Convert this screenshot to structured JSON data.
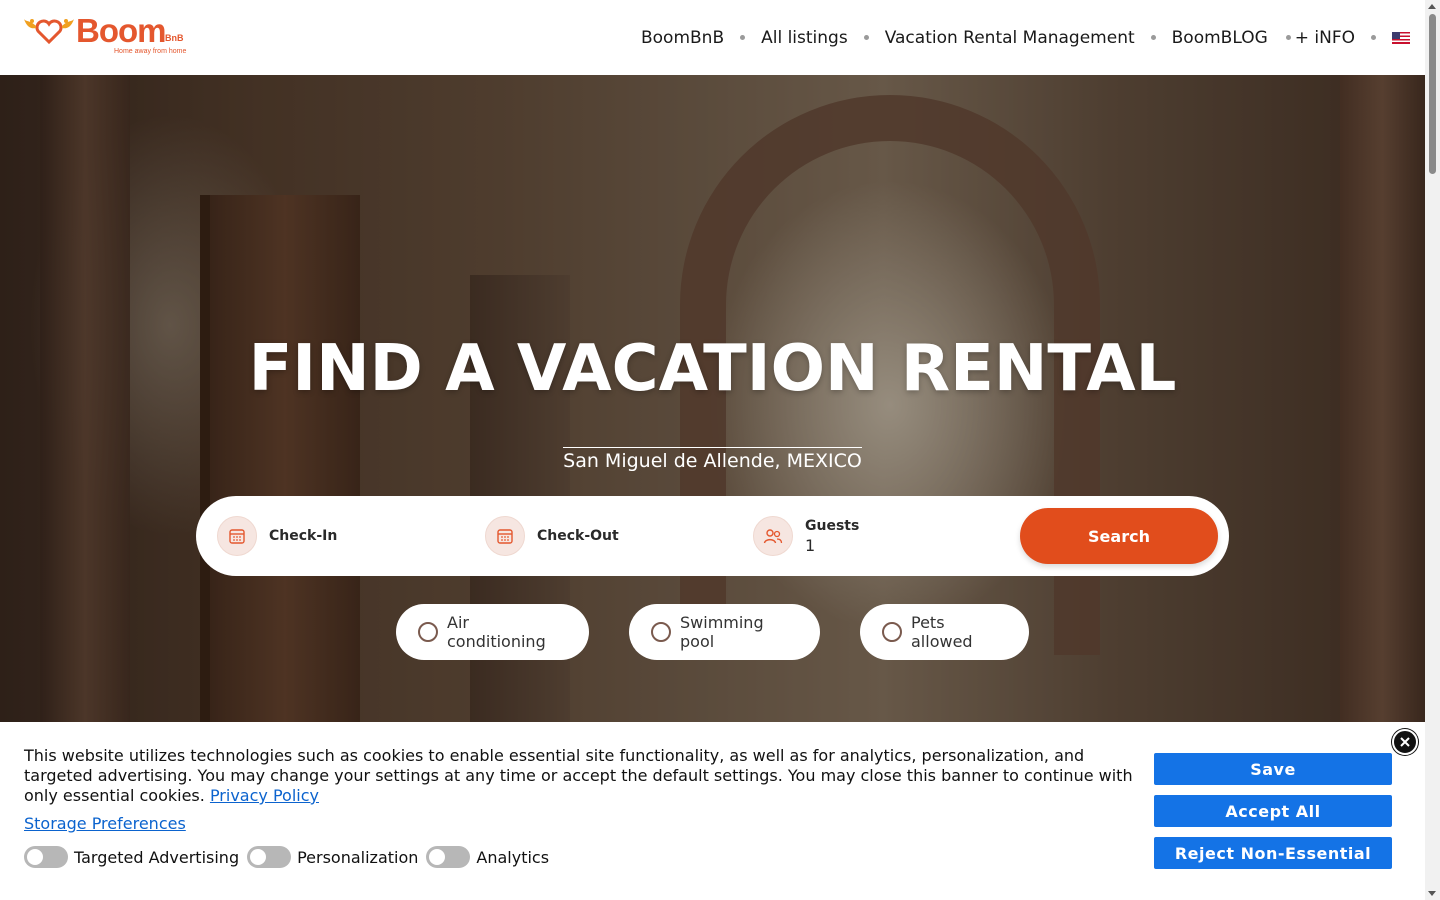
{
  "header": {
    "logo": {
      "word": "Boom",
      "suffix": "BnB",
      "tagline": "Home away from home"
    },
    "nav": [
      {
        "label": "BoomBnB"
      },
      {
        "label": "All listings"
      },
      {
        "label": "Vacation Rental Management"
      },
      {
        "label": "BoomBLOG"
      },
      {
        "label": "+ iNFO"
      }
    ],
    "language_icon": "us-flag-icon"
  },
  "hero": {
    "title": "FIND A VACATION RENTAL",
    "location": "San Miguel de Allende, MEXICO"
  },
  "search": {
    "checkin_label": "Check-In",
    "checkout_label": "Check-Out",
    "guests_label": "Guests",
    "guests_value": "1",
    "button_label": "Search",
    "accent_color": "#e14d1c"
  },
  "filters": [
    {
      "label": "Air conditioning",
      "checked": false
    },
    {
      "label": "Swimming pool",
      "checked": false
    },
    {
      "label": "Pets allowed",
      "checked": false
    }
  ],
  "cookie_banner": {
    "text": "This website utilizes technologies such as cookies to enable essential site functionality, as well as for analytics, personalization, and targeted advertising. You may change your settings at any time or accept the default settings. You may close this banner to continue with only essential cookies.",
    "privacy_link": "Privacy Policy",
    "storage_link": "Storage Preferences",
    "toggles": [
      {
        "label": "Targeted Advertising",
        "on": false
      },
      {
        "label": "Personalization",
        "on": false
      },
      {
        "label": "Analytics",
        "on": false
      }
    ],
    "buttons": {
      "save": "Save",
      "accept": "Accept All",
      "reject": "Reject Non-Essential"
    },
    "button_color": "#1473e6"
  }
}
